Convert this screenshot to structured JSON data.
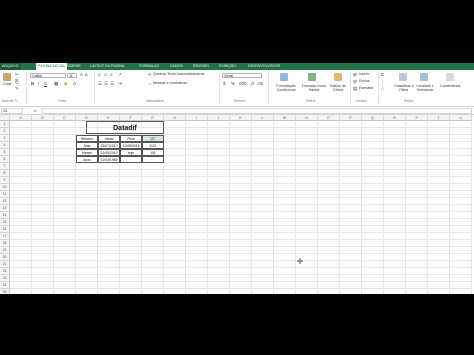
{
  "tabs": {
    "file": "ARQUIVO",
    "home": "PÁGINA INICIAL",
    "insert": "INSERIR",
    "layout": "LAYOUT DA PÁGINA",
    "formulas": "FÓRMULAS",
    "data": "DADOS",
    "review": "REVISÃO",
    "view": "EXIBIÇÃO",
    "developer": "DESENVOLVEDOR"
  },
  "ribbon": {
    "paste": "Colar",
    "font_name": "Calibri",
    "font_size": "11",
    "wrap_text": "Quebrar Texto Automaticamente",
    "merge_center": "Mesclar e Centralizar",
    "number_format": "Geral",
    "conditional_formatting": "Formatação Condicional",
    "format_as_table": "Formatar como Tabela",
    "cell_styles": "Estilos de Célula",
    "insert_cells": "Inserir",
    "delete_cells": "Excluir",
    "format_cells": "Formatar",
    "sort_filter": "Classificar e Filtrar",
    "find_select": "Localizar e Selecionar",
    "ideas": "Comentários",
    "groups": {
      "clipboard": "Área de Tr...",
      "font": "Fonte",
      "alignment": "Alinhamento",
      "number": "Número",
      "styles": "Estilos",
      "cells": "Células",
      "editing": "Edição"
    }
  },
  "formula_bar": {
    "name_box": "G1",
    "fx": "fx",
    "content": ""
  },
  "columns": [
    "A",
    "B",
    "C",
    "D",
    "E",
    "F",
    "G",
    "H",
    "I",
    "J",
    "K",
    "L",
    "M",
    "N",
    "O",
    "P",
    "Q",
    "R",
    "S",
    "T",
    "U"
  ],
  "rows": [
    "1",
    "2",
    "3",
    "4",
    "5",
    "6",
    "7",
    "8",
    "9",
    "10",
    "11",
    "12",
    "13",
    "14",
    "15",
    "16",
    "17",
    "18",
    "19",
    "20",
    "21",
    "22",
    "23",
    "24",
    "25"
  ],
  "sheet": {
    "title": "Datadif",
    "headers": [
      "Retorno",
      "Inicial",
      "Final",
      "QT."
    ],
    "rows": [
      [
        "Dias",
        "15/07/2010",
        "11/08/2014",
        "1121"
      ],
      [
        "Meses",
        "31/05/2010",
        "hoje",
        "101"
      ],
      [
        "Anos",
        "01/02/1984",
        "",
        ""
      ]
    ]
  }
}
